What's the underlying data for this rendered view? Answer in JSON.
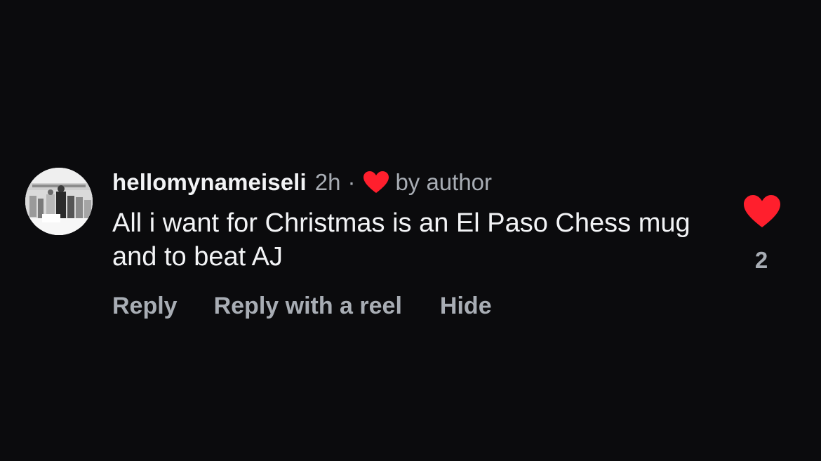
{
  "comment": {
    "username": "hellomynameiseli",
    "timestamp": "2h",
    "separator": "·",
    "author_badge": "by author",
    "text": "All i want for Christmas is an El Paso Chess mug and to beat AJ",
    "like_count": "2"
  },
  "actions": {
    "reply": "Reply",
    "reply_with_reel": "Reply with a reel",
    "hide": "Hide"
  },
  "icons": {
    "author_heart": "heart-icon",
    "like_heart": "heart-icon"
  },
  "colors": {
    "background": "#0b0b0d",
    "primary_text": "#f2f3f5",
    "secondary_text": "#a8adb4",
    "heart": "#ff1f2d"
  }
}
